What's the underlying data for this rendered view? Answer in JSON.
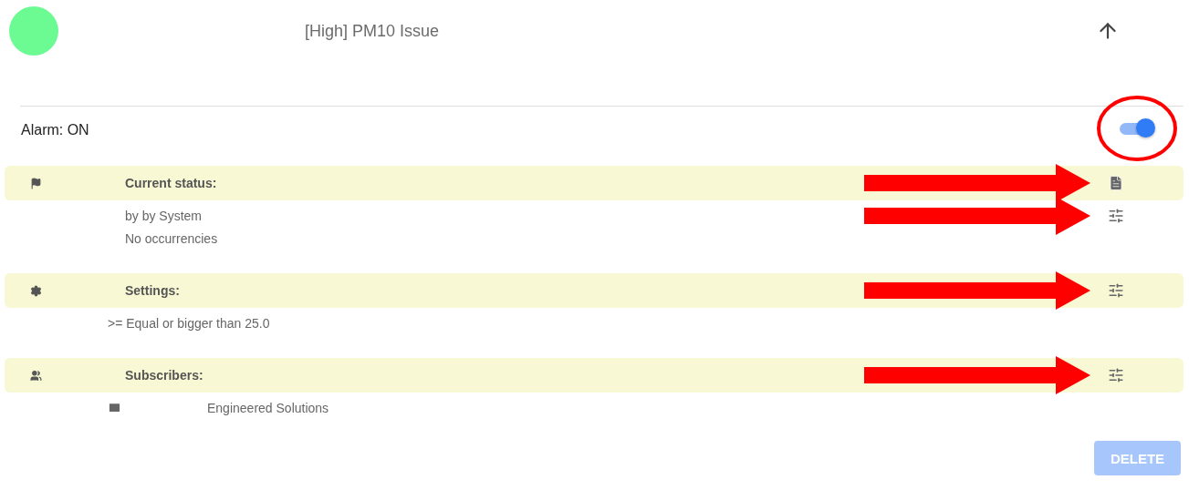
{
  "header": {
    "title": "[High] PM10 Issue"
  },
  "alarm": {
    "label": "Alarm: ON",
    "on": true,
    "annotated": true
  },
  "sections": [
    {
      "kind": "status",
      "title": "Current status:",
      "action": {
        "kind": "document",
        "annotated": true
      },
      "lines": [
        {
          "kind": "text",
          "text": "by by System",
          "action": {
            "kind": "tune",
            "annotated": true
          }
        },
        {
          "kind": "text",
          "text": "No occurrencies"
        }
      ]
    },
    {
      "kind": "settings",
      "title": "Settings:",
      "action": {
        "kind": "tune",
        "annotated": true
      },
      "lines": [
        {
          "kind": "condition",
          "text": ">= Equal or bigger than 25.0"
        }
      ]
    },
    {
      "kind": "subscribers",
      "title": "Subscribers:",
      "action": {
        "kind": "tune",
        "annotated": true
      },
      "lines": [
        {
          "kind": "email",
          "text": "Engineered Solutions"
        }
      ]
    }
  ],
  "delete_button": {
    "label": "DELETE",
    "disabled": true
  }
}
